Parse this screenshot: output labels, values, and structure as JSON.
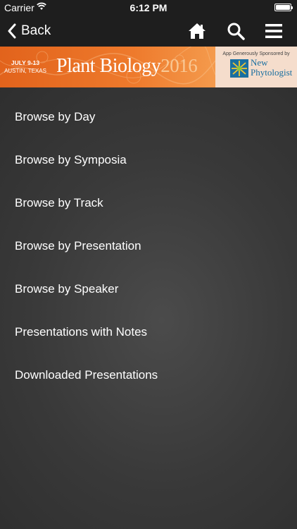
{
  "status_bar": {
    "carrier": "Carrier",
    "time": "6:12 PM",
    "battery_level": 1.0
  },
  "nav_bar": {
    "back_label": "Back",
    "icons": [
      "home-icon",
      "search-icon",
      "hamburger-menu-icon"
    ]
  },
  "banner": {
    "dates": "JULY 9-13",
    "location": "AUSTIN, TEXAS",
    "title": "Plant Biology",
    "year": "2016",
    "sponsor_text": "App Generously Sponsored by",
    "sponsor_name_line1": "New",
    "sponsor_name_line2": "Phytologist"
  },
  "menu": {
    "items": [
      {
        "label": "Browse by Day"
      },
      {
        "label": "Browse by Symposia"
      },
      {
        "label": "Browse by Track"
      },
      {
        "label": "Browse by Presentation"
      },
      {
        "label": "Browse by Speaker"
      },
      {
        "label": "Presentations with Notes"
      },
      {
        "label": "Downloaded Presentations"
      }
    ]
  },
  "colors": {
    "bar_background": "#1e1e1e",
    "banner_orange": "#ee7a2c",
    "sponsor_blue": "#1a6fa0",
    "content_background": "#393939"
  }
}
